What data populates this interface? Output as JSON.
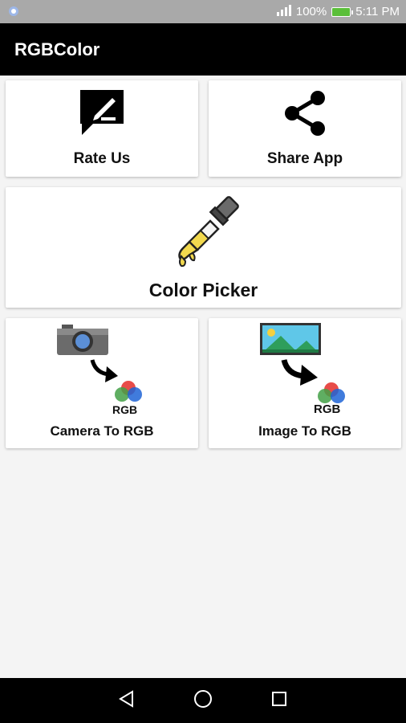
{
  "status_bar": {
    "battery": "100%",
    "time": "5:11 PM"
  },
  "app_bar": {
    "title": "RGBColor"
  },
  "cards": {
    "rate": {
      "label": "Rate Us",
      "icon": "rate-feedback-icon"
    },
    "share": {
      "label": "Share App",
      "icon": "share-icon"
    },
    "picker": {
      "label": "Color Picker",
      "icon": "dropper-icon"
    },
    "camera": {
      "label": "Camera To RGB",
      "badge": "RGB",
      "icon": "camera-icon"
    },
    "image": {
      "label": "Image To RGB",
      "badge": "RGB",
      "icon": "image-icon"
    }
  },
  "nav": {
    "back": "back-icon",
    "home": "home-icon",
    "recents": "recents-icon"
  },
  "colors": {
    "app_bar": "#000000",
    "status_bar": "#a9a9a9",
    "background": "#f4f4f4",
    "dropper_liquid": "#f2d94e"
  }
}
